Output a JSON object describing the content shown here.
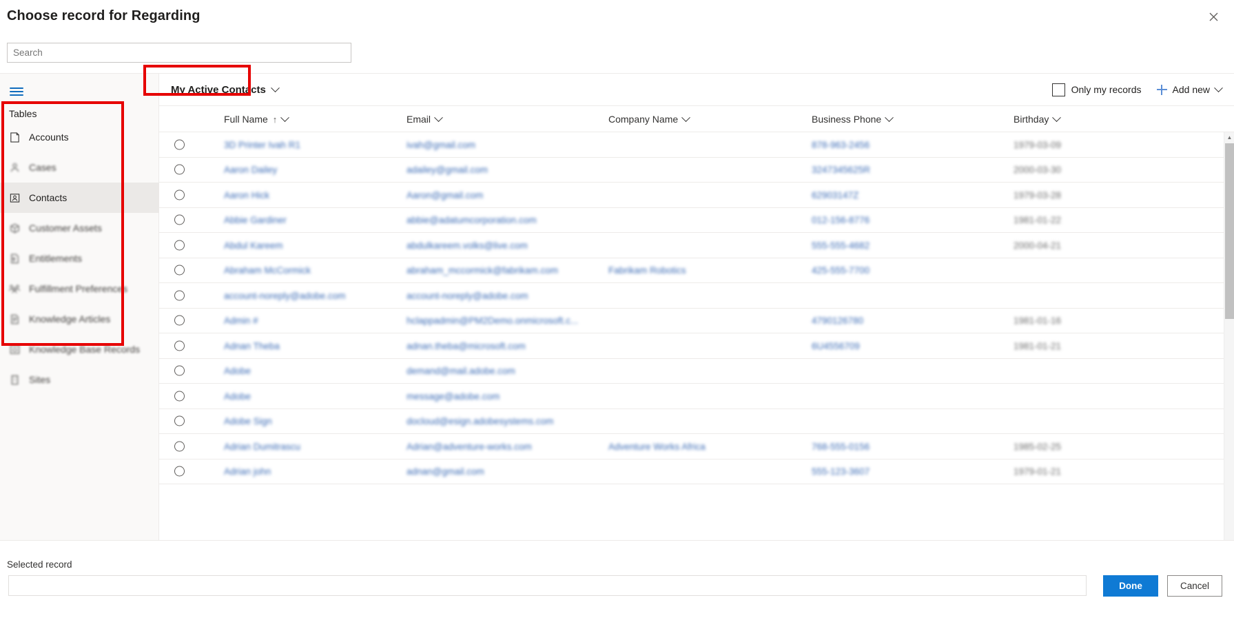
{
  "dialog": {
    "title": "Choose record for Regarding",
    "close_icon": "close-icon"
  },
  "search": {
    "placeholder": "Search",
    "value": ""
  },
  "sidebar": {
    "menu_icon": "hamburger-icon",
    "section_label": "Tables",
    "items": [
      {
        "label": "Accounts",
        "icon": "account-icon",
        "selected": false,
        "blurred": false
      },
      {
        "label": "Cases",
        "icon": "case-person-icon",
        "selected": false,
        "blurred": true
      },
      {
        "label": "Contacts",
        "icon": "contact-card-icon",
        "selected": true,
        "blurred": false
      },
      {
        "label": "Customer Assets",
        "icon": "box-asset-icon",
        "selected": false,
        "blurred": true
      },
      {
        "label": "Entitlements",
        "icon": "entitlement-doc-icon",
        "selected": false,
        "blurred": true
      },
      {
        "label": "Fulfillment Preferences",
        "icon": "people-group-icon",
        "selected": false,
        "blurred": true
      },
      {
        "label": "Knowledge Articles",
        "icon": "article-document-icon",
        "selected": false,
        "blurred": true
      },
      {
        "label": "Knowledge Base Records",
        "icon": "knowledge-base-icon",
        "selected": false,
        "blurred": true
      },
      {
        "label": "Sites",
        "icon": "site-building-icon",
        "selected": false,
        "blurred": true
      }
    ]
  },
  "toolbar": {
    "view_name": "My Active Contacts",
    "view_chevron_icon": "chevron-down-icon",
    "only_my_records_label": "Only my records",
    "only_my_records_checked": false,
    "add_new_label": "Add new",
    "add_new_plus_icon": "plus-icon",
    "add_new_chevron_icon": "chevron-down-icon"
  },
  "grid": {
    "columns": [
      {
        "label": "Full Name",
        "sorted": true,
        "sort_icon": "sort-ascending-arrow",
        "menu_icon": "chevron-down-icon"
      },
      {
        "label": "Email",
        "sorted": false,
        "menu_icon": "chevron-down-icon"
      },
      {
        "label": "Company Name",
        "sorted": false,
        "menu_icon": "chevron-down-icon"
      },
      {
        "label": "Business Phone",
        "sorted": false,
        "menu_icon": "chevron-down-icon"
      },
      {
        "label": "Birthday",
        "sorted": false,
        "menu_icon": "chevron-down-icon"
      }
    ],
    "rows": [
      {
        "full_name": "3D Printer Ivah R1",
        "email": "ivah@gmail.com",
        "company": "",
        "phone": "878-963-2456",
        "birthday": "1979-03-09"
      },
      {
        "full_name": "Aaron Dailey",
        "email": "adailey@gmail.com",
        "company": "",
        "phone": "3247345625R",
        "birthday": "2000-03-30"
      },
      {
        "full_name": "Aaron Hick",
        "email": "Aaron@gmail.com",
        "company": "",
        "phone": "62903147Z",
        "birthday": "1979-03-28"
      },
      {
        "full_name": "Abbie Gardiner",
        "email": "abbie@adatumcorporation.com",
        "company": "",
        "phone": "012-156-8776",
        "birthday": "1981-01-22"
      },
      {
        "full_name": "Abdul Kareem",
        "email": "abdulkareem.volks@live.com",
        "company": "",
        "phone": "555-555-4682",
        "birthday": "2000-04-21"
      },
      {
        "full_name": "Abraham McCormick",
        "email": "abraham_mccormick@fabrikam.com",
        "company": "Fabrikam Robotics",
        "phone": "425-555-7700",
        "birthday": ""
      },
      {
        "full_name": "account-noreply@adobe.com",
        "email": "account-noreply@adobe.com",
        "company": "",
        "phone": "",
        "birthday": ""
      },
      {
        "full_name": "Admin #",
        "email": "hclappadmin@PM2Demo.onmicrosoft.c...",
        "company": "",
        "phone": "4790126780",
        "birthday": "1981-01-16"
      },
      {
        "full_name": "Adnan Theba",
        "email": "adnan.theba@microsoft.com",
        "company": "",
        "phone": "6U4556709",
        "birthday": "1981-01-21"
      },
      {
        "full_name": "Adobe",
        "email": "demand@mail.adobe.com",
        "company": "",
        "phone": "",
        "birthday": ""
      },
      {
        "full_name": "Adobe",
        "email": "message@adobe.com",
        "company": "",
        "phone": "",
        "birthday": ""
      },
      {
        "full_name": "Adobe Sign",
        "email": "docloud@esign.adobesystems.com",
        "company": "",
        "phone": "",
        "birthday": ""
      },
      {
        "full_name": "Adrian Dumitrascu",
        "email": "Adrian@adventure-works.com",
        "company": "Adventure Works Africa",
        "phone": "768-555-0156",
        "birthday": "1985-02-25"
      },
      {
        "full_name": "Adrian john",
        "email": "adnan@gmail.com",
        "company": "",
        "phone": "555-123-3607",
        "birthday": "1979-01-21"
      }
    ]
  },
  "footer": {
    "selected_record_label": "Selected record",
    "selected_record_value": "",
    "done_label": "Done",
    "cancel_label": "Cancel"
  },
  "colors": {
    "accent": "#0f7ad4",
    "annotation": "#e60000",
    "link": "#3b6bb5",
    "sidebar_bg": "#faf9f8"
  }
}
